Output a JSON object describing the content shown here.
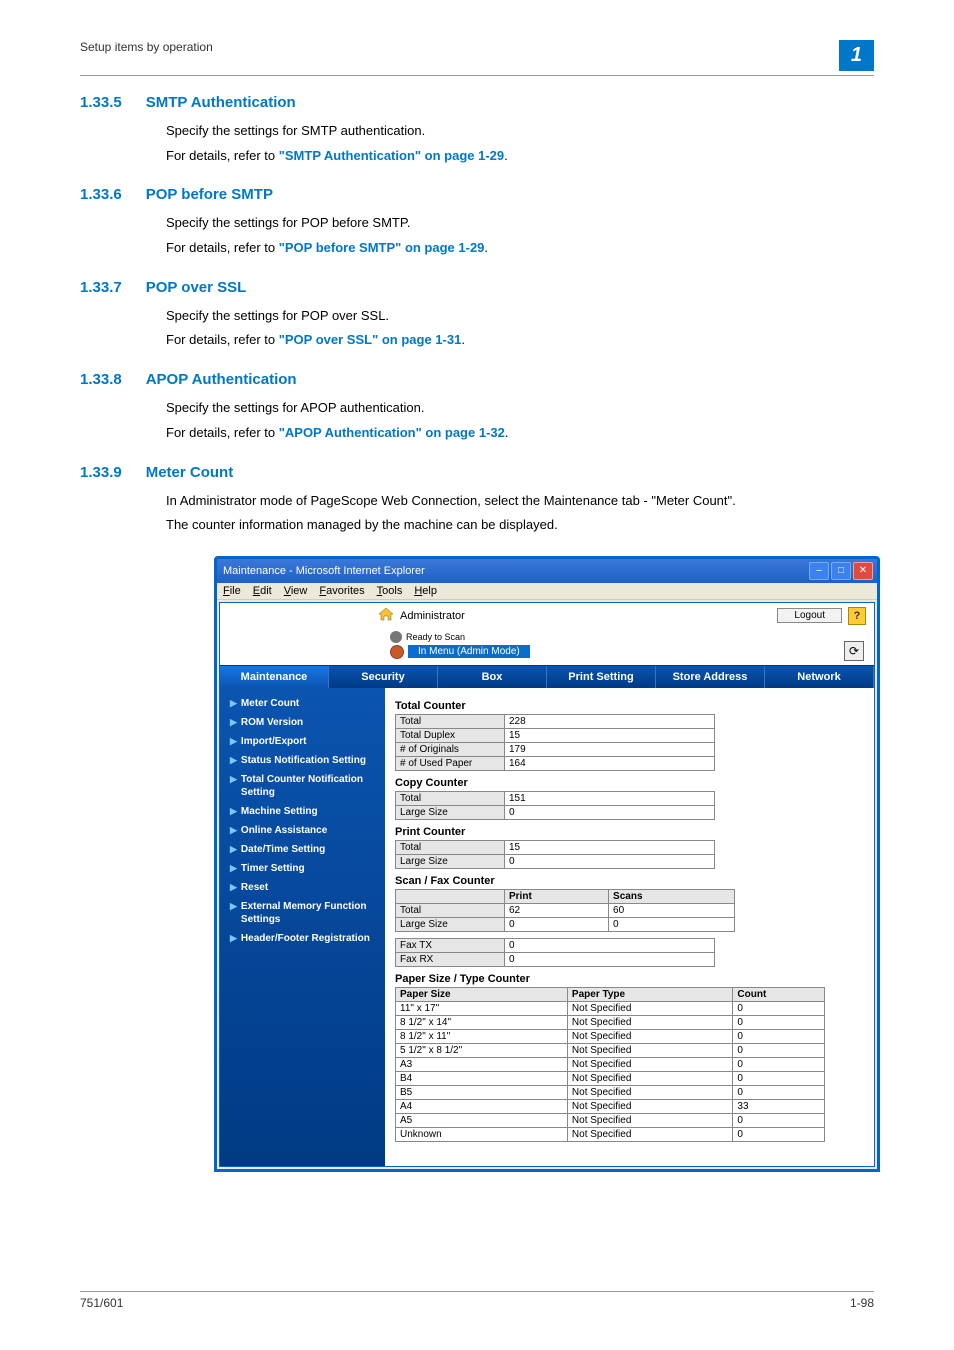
{
  "header": {
    "breadcrumb": "Setup items by operation",
    "chapter": "1"
  },
  "sections": [
    {
      "num": "1.33.5",
      "title": "SMTP Authentication",
      "body": "Specify the settings for SMTP authentication.",
      "ref_prefix": "For details, refer to ",
      "ref_link": "\"SMTP Authentication\" on page 1-29"
    },
    {
      "num": "1.33.6",
      "title": "POP before SMTP",
      "body": "Specify the settings for POP before SMTP.",
      "ref_prefix": "For details, refer to ",
      "ref_link": "\"POP before SMTP\" on page 1-29"
    },
    {
      "num": "1.33.7",
      "title": "POP over SSL",
      "body": "Specify the settings for POP over SSL.",
      "ref_prefix": "For details, refer to ",
      "ref_link": "\"POP over SSL\" on page 1-31"
    },
    {
      "num": "1.33.8",
      "title": "APOP Authentication",
      "body": "Specify the settings for APOP authentication.",
      "ref_prefix": "For details, refer to ",
      "ref_link": "\"APOP Authentication\" on page 1-32"
    }
  ],
  "meter": {
    "num": "1.33.9",
    "title": "Meter Count",
    "line1": "In Administrator mode of PageScope Web Connection, select the Maintenance tab - \"Meter Count\".",
    "line2": "The counter information managed by the machine can be displayed."
  },
  "browser": {
    "title": "Maintenance - Microsoft Internet Explorer",
    "menus": [
      "File",
      "Edit",
      "View",
      "Favorites",
      "Tools",
      "Help"
    ],
    "admin_label": "Administrator",
    "logout": "Logout",
    "status1": "Ready to Scan",
    "status2": "In Menu (Admin Mode)",
    "tabs": [
      "Maintenance",
      "Security",
      "Box",
      "Print Setting",
      "Store Address",
      "Network"
    ],
    "sidebar": [
      "Meter Count",
      "ROM Version",
      "Import/Export",
      "Status Notification Setting",
      "Total Counter Notification Setting",
      "Machine Setting",
      "Online Assistance",
      "Date/Time Setting",
      "Timer Setting",
      "Reset",
      "External Memory Function Settings",
      "Header/Footer Registration"
    ],
    "groups": {
      "total_counter": {
        "title": "Total Counter",
        "rows": [
          [
            "Total",
            "228"
          ],
          [
            "Total Duplex",
            "15"
          ],
          [
            "# of Originals",
            "179"
          ],
          [
            "# of Used Paper",
            "164"
          ]
        ]
      },
      "copy_counter": {
        "title": "Copy Counter",
        "rows": [
          [
            "Total",
            "151"
          ],
          [
            "Large Size",
            "0"
          ]
        ]
      },
      "print_counter": {
        "title": "Print Counter",
        "rows": [
          [
            "Total",
            "15"
          ],
          [
            "Large Size",
            "0"
          ]
        ]
      },
      "scanfax": {
        "title": "Scan / Fax Counter",
        "head": [
          "",
          "Print",
          "Scans"
        ],
        "rows": [
          [
            "Total",
            "62",
            "60"
          ],
          [
            "Large Size",
            "0",
            "0"
          ]
        ],
        "extra": [
          [
            "Fax TX",
            "0"
          ],
          [
            "Fax RX",
            "0"
          ]
        ]
      },
      "paper": {
        "title": "Paper Size / Type Counter",
        "head": [
          "Paper Size",
          "Paper Type",
          "Count"
        ],
        "rows": [
          [
            "11\" x 17\"",
            "Not Specified",
            "0"
          ],
          [
            "8 1/2\" x 14\"",
            "Not Specified",
            "0"
          ],
          [
            "8 1/2\" x 11\"",
            "Not Specified",
            "0"
          ],
          [
            "5 1/2\" x 8 1/2\"",
            "Not Specified",
            "0"
          ],
          [
            "A3",
            "Not Specified",
            "0"
          ],
          [
            "B4",
            "Not Specified",
            "0"
          ],
          [
            "B5",
            "Not Specified",
            "0"
          ],
          [
            "A4",
            "Not Specified",
            "33"
          ],
          [
            "A5",
            "Not Specified",
            "0"
          ],
          [
            "Unknown",
            "Not Specified",
            "0"
          ]
        ]
      }
    }
  },
  "footer": {
    "left": "751/601",
    "right": "1-98"
  }
}
